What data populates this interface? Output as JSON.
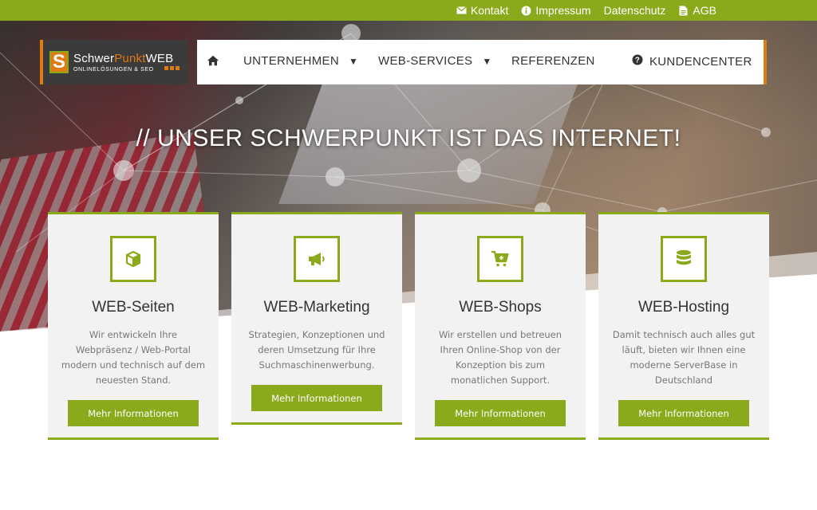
{
  "topbar": {
    "links": [
      {
        "label": "Kontakt",
        "icon": "envelope-icon"
      },
      {
        "label": "Impressum",
        "icon": "info-icon"
      },
      {
        "label": "Datenschutz",
        "icon": ""
      },
      {
        "label": "AGB",
        "icon": "document-icon"
      }
    ]
  },
  "logo": {
    "title_part1": "Schwer",
    "title_part2": "Punkt",
    "title_part3": "WEB",
    "mark": "S",
    "subtitle": "ONLINELÖSUNGEN & SEO"
  },
  "nav": {
    "items": [
      {
        "label": "UNTERNEHMEN",
        "has_dropdown": true
      },
      {
        "label": "WEB-SERVICES",
        "has_dropdown": true
      },
      {
        "label": "REFERENZEN",
        "has_dropdown": false
      },
      {
        "label": "KUNDENCENTER",
        "icon": "question-icon"
      }
    ]
  },
  "hero": {
    "headline": "// UNSER SCHWERPUNKT IST DAS INTERNET!"
  },
  "cards": [
    {
      "title": "WEB-Seiten",
      "icon": "cube-icon",
      "description": "Wir entwickeln Ihre Webpräsenz / Web-Portal modern und technisch auf dem neuesten Stand.",
      "button": "Mehr Informationen"
    },
    {
      "title": "WEB-Marketing",
      "icon": "megaphone-icon",
      "description": "Strategien, Konzeptionen und deren Umsetzung für Ihre Suchmaschinenwerbung.",
      "button": "Mehr Informationen"
    },
    {
      "title": "WEB-Shops",
      "icon": "cart-icon",
      "description": "Wir erstellen und betreuen Ihren Online-Shop von der Konzeption bis zum monatlichen Support.",
      "button": "Mehr Informationen"
    },
    {
      "title": "WEB-Hosting",
      "icon": "database-icon",
      "description": "Damit technisch auch alles gut läuft, bieten wir Ihnen eine moderne ServerBase in Deutschland",
      "button": "Mehr Informationen"
    }
  ],
  "colors": {
    "accent_green": "#8aaa1c",
    "accent_orange": "#e07b12",
    "logo_bg": "#3b3b3b"
  }
}
